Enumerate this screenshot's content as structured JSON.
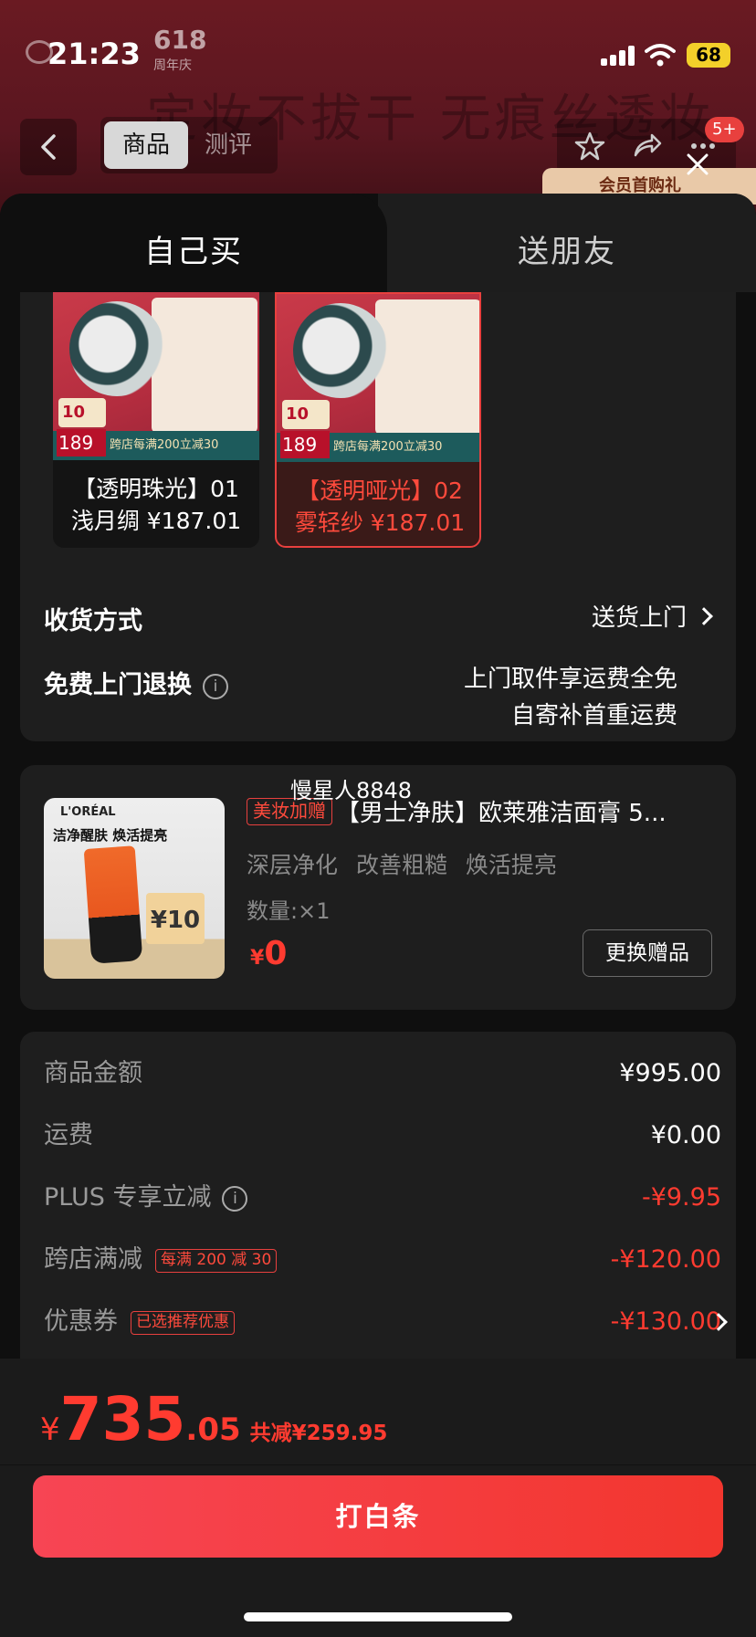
{
  "status_bar": {
    "time": "21:23",
    "battery": "68",
    "brand_badge_top": "618",
    "brand_badge_bottom": "周年庆"
  },
  "background": {
    "banner_text": "定妆不拔干 无痕丝透妆",
    "nav_tabs": [
      "商品",
      "测评"
    ],
    "cart_badge": "5+",
    "promo_chip": "会员首购礼"
  },
  "sheet": {
    "tabs": [
      "自己买",
      "送朋友"
    ],
    "variants": [
      {
        "name_line1": "【透明珠光】01",
        "name_line2": "浅月绸 ¥187.01",
        "selected": false,
        "img_price": "189",
        "img_strip": "跨店每满200立减30",
        "img_coupon": "10"
      },
      {
        "name_line1": "【透明哑光】02",
        "name_line2": "雾轻纱 ¥187.01",
        "selected": true,
        "img_price": "189",
        "img_strip": "跨店每满200立减30",
        "img_coupon": "10"
      }
    ],
    "delivery": {
      "label": "收货方式",
      "value": "送货上门"
    },
    "return_service": {
      "label": "免费上门退换",
      "info_icon": "i",
      "value_line1": "上门取件享运费全免",
      "value_line2": "自寄补首重运费"
    }
  },
  "gift": {
    "owner": "慢星人8848",
    "tag": "美妆加赠",
    "title": "【男士净肤】欧莱雅洁面膏 5...",
    "description": "深层净化 改善粗糙 焕活提亮",
    "quantity": "数量:×1",
    "price_symbol": "¥",
    "price": "0",
    "swap_button": "更换赠品",
    "image": {
      "brand": "L'ORÉAL",
      "headline": "洁净醒肤 焕活提亮",
      "coupon": "¥10"
    }
  },
  "summary": {
    "rows": [
      {
        "label": "商品金额",
        "value": "¥995.00",
        "red": false
      },
      {
        "label": "运费",
        "value": "¥0.00",
        "red": false
      },
      {
        "label": "PLUS 专享立减",
        "value": "-¥9.95",
        "red": true,
        "info": "i"
      },
      {
        "label": "跨店满减",
        "tag": "每满 200 减 30",
        "value": "-¥120.00",
        "red": true
      },
      {
        "label": "优惠券",
        "tag": "已选推荐优惠",
        "value": "-¥130.00",
        "red": true,
        "chevron": true
      }
    ]
  },
  "footer": {
    "currency": "¥",
    "total_int": "735",
    "total_dec": ".05",
    "saved": "共减¥259.95",
    "pay_button": "打白条"
  },
  "colors": {
    "accent_red": "#ff3b30",
    "button_red": "#f2362e",
    "card_bg": "#1e1e1e",
    "sheet_bg": "#0f0f0f"
  }
}
